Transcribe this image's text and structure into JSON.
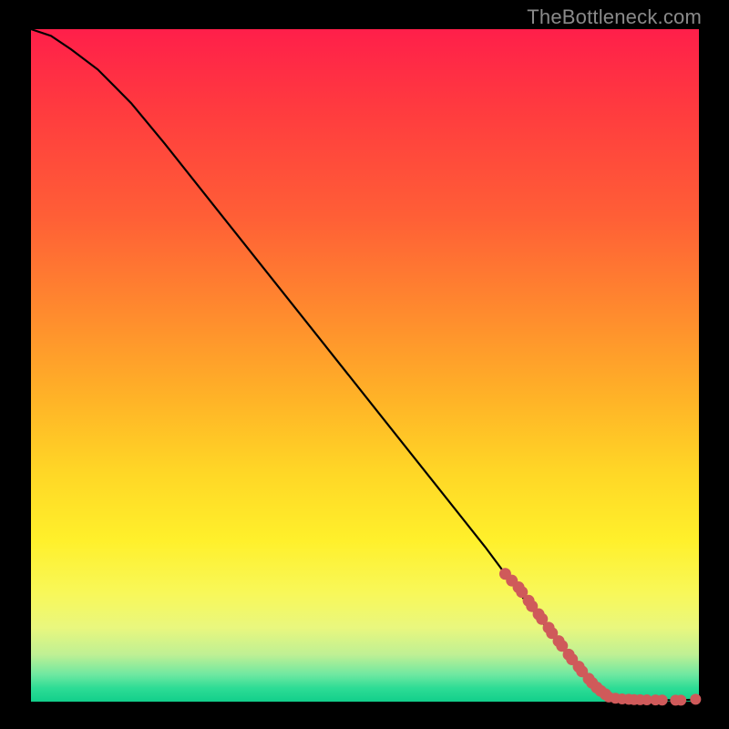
{
  "watermark": "TheBottleneck.com",
  "colors": {
    "gradient_top": "#ff1f4a",
    "gradient_mid": "#ffd726",
    "gradient_bottom": "#12cf8b",
    "curve": "#000000",
    "markers": "#cf5a5a",
    "background": "#000000"
  },
  "chart_data": {
    "type": "line",
    "title": "",
    "xlabel": "",
    "ylabel": "",
    "xlim": [
      0,
      100
    ],
    "ylim": [
      0,
      100
    ],
    "curve": {
      "x": [
        0,
        3,
        6,
        10,
        15,
        20,
        28,
        36,
        44,
        52,
        60,
        68,
        74,
        78,
        81,
        84,
        87,
        90,
        93,
        96,
        100
      ],
      "y": [
        100,
        99,
        97,
        94,
        89,
        83,
        73,
        63,
        53,
        43,
        33,
        23,
        15,
        10,
        6,
        3,
        1,
        0.5,
        0.3,
        0.2,
        0.3
      ]
    },
    "markers_segment_a": {
      "comment": "dense markers along the steep falling segment near bottom-right",
      "x": [
        71,
        72,
        73,
        73.5,
        74.5,
        75,
        76,
        76.5,
        77.5,
        78,
        79,
        79.5,
        80.5,
        81,
        82,
        82.5,
        83.5,
        84,
        84.7,
        85.3,
        86
      ],
      "y": [
        19,
        18,
        17,
        16.3,
        15,
        14.2,
        13,
        12.3,
        11,
        10.2,
        9,
        8.3,
        7,
        6.3,
        5.2,
        4.5,
        3.4,
        2.8,
        2.1,
        1.6,
        1.1
      ]
    },
    "markers_segment_b": {
      "comment": "markers sitting on the flat tail along the x-axis",
      "x": [
        86.5,
        87.5,
        88.5,
        89.5,
        90.3,
        91.2,
        92.2,
        93.5,
        94.5,
        96.5,
        97.3,
        99.5
      ],
      "y": [
        0.7,
        0.5,
        0.4,
        0.35,
        0.3,
        0.28,
        0.27,
        0.25,
        0.23,
        0.22,
        0.22,
        0.35
      ]
    }
  }
}
